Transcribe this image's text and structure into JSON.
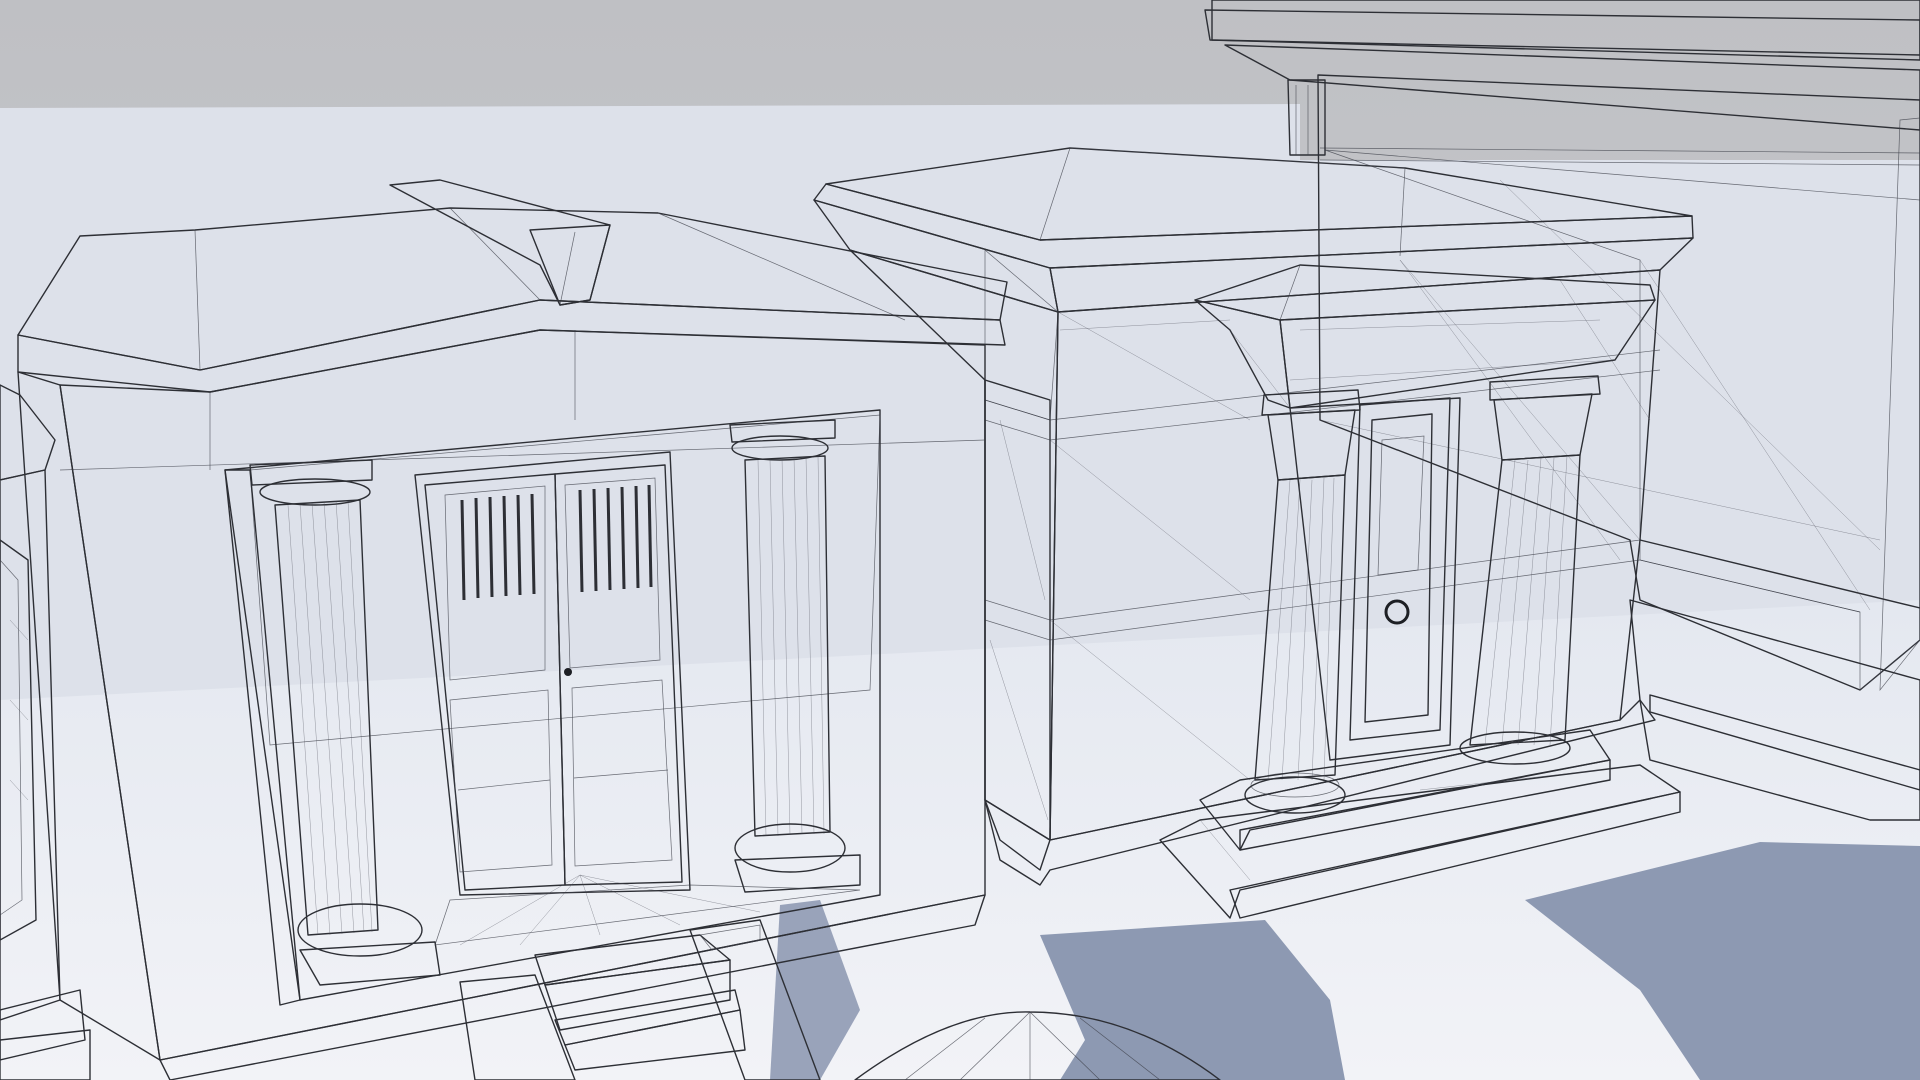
{
  "image": {
    "kind": "3d-wireframe-render",
    "subject": "mausoleums",
    "palette": {
      "sky": "#c9cacd",
      "far_plane": "#dfe3ec",
      "ground": "#eef0f5",
      "shadow": "#8e9ab3",
      "surface_light": "#f3f4f7",
      "surface_mid": "#dcdee4",
      "surface_dark": "#b9bcc5",
      "wire": "#2d2f35"
    }
  }
}
